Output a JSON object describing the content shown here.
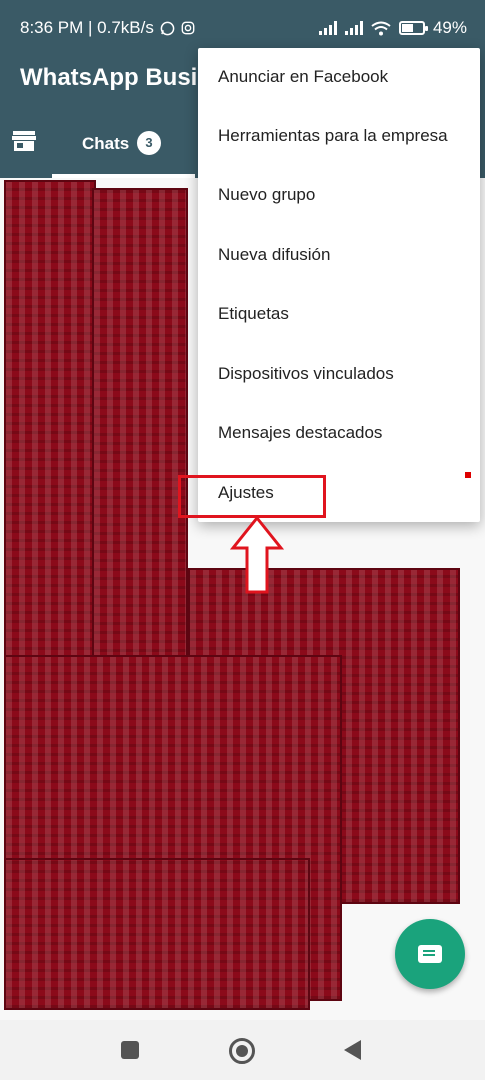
{
  "status_bar": {
    "time_speed": "8:36 PM | 0.7kB/s",
    "battery": "49%",
    "icons": [
      "whatsapp-icon",
      "instagram-icon",
      "signal-icon",
      "signal-icon",
      "wifi-icon",
      "battery-icon"
    ]
  },
  "app": {
    "title": "WhatsApp Business"
  },
  "tabs": {
    "chats_label": "Chats",
    "chats_badge": "3",
    "shop_icon": "store-icon"
  },
  "menu": {
    "items": [
      {
        "label": "Anunciar en Facebook"
      },
      {
        "label": "Herramientas para la empresa"
      },
      {
        "label": "Nuevo grupo"
      },
      {
        "label": "Nueva difusión"
      },
      {
        "label": "Etiquetas"
      },
      {
        "label": "Dispositivos vinculados"
      },
      {
        "label": "Mensajes destacados"
      },
      {
        "label": "Ajustes"
      }
    ]
  },
  "colors": {
    "header": "#3a5a66",
    "fab": "#1aa37c",
    "highlight": "#e0141e",
    "redaction": "#8b0a1a"
  },
  "fab_icon": "new-chat-icon",
  "nav_icons": [
    "recents-icon",
    "home-icon",
    "back-icon"
  ]
}
